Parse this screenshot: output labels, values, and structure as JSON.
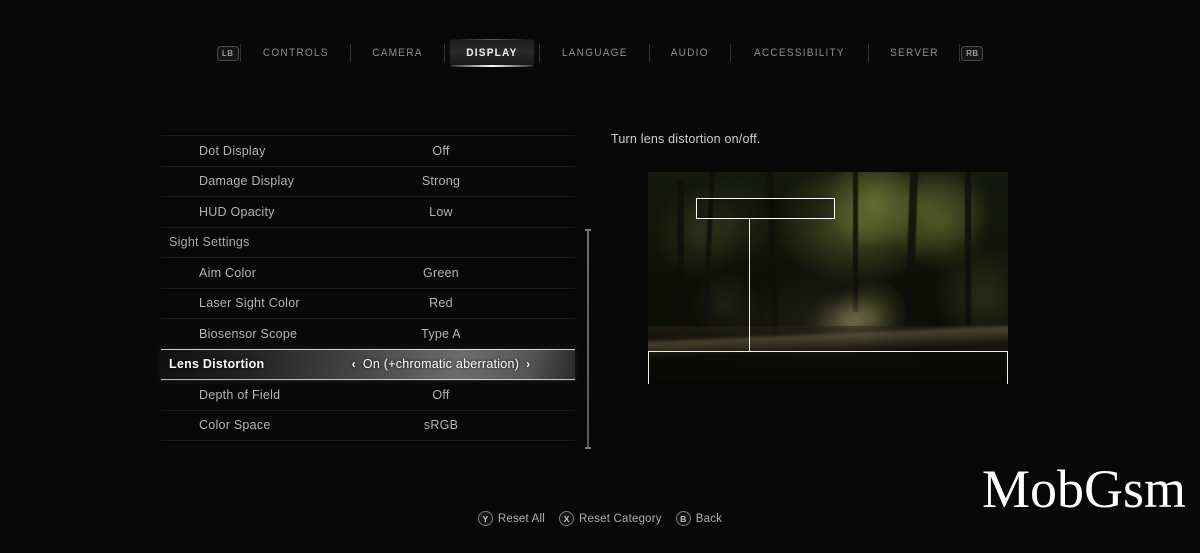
{
  "tabbar": {
    "left_bumper": "LB",
    "right_bumper": "RB",
    "tabs": [
      {
        "label": "CONTROLS",
        "active": false
      },
      {
        "label": "CAMERA",
        "active": false
      },
      {
        "label": "DISPLAY",
        "active": true
      },
      {
        "label": "LANGUAGE",
        "active": false
      },
      {
        "label": "AUDIO",
        "active": false
      },
      {
        "label": "ACCESSIBILITY",
        "active": false
      },
      {
        "label": "SERVER",
        "active": false
      }
    ]
  },
  "settings": {
    "rows": [
      {
        "label": "Dot Display",
        "value": "Off",
        "type": "option",
        "selected": false
      },
      {
        "label": "Damage Display",
        "value": "Strong",
        "type": "option",
        "selected": false
      },
      {
        "label": "HUD Opacity",
        "value": "Low",
        "type": "option",
        "selected": false
      },
      {
        "label": "Sight Settings",
        "value": "",
        "type": "header",
        "selected": false
      },
      {
        "label": "Aim Color",
        "value": "Green",
        "type": "option",
        "selected": false
      },
      {
        "label": "Laser Sight Color",
        "value": "Red",
        "type": "option",
        "selected": false
      },
      {
        "label": "Biosensor Scope",
        "value": "Type A",
        "type": "option",
        "selected": false
      },
      {
        "label": "Lens Distortion",
        "value": "On (+chromatic aberration)",
        "type": "option",
        "selected": true
      },
      {
        "label": "Depth of Field",
        "value": "Off",
        "type": "option",
        "selected": false
      },
      {
        "label": "Color Space",
        "value": "sRGB",
        "type": "option",
        "selected": false
      }
    ],
    "arrow_left": "‹",
    "arrow_right": "›"
  },
  "detail": {
    "description": "Turn lens distortion on/off."
  },
  "footer": {
    "hints": [
      {
        "glyph": "Y",
        "label": "Reset All"
      },
      {
        "glyph": "X",
        "label": "Reset Category"
      },
      {
        "glyph": "B",
        "label": "Back"
      }
    ]
  },
  "watermark": {
    "text": "MobGsm"
  },
  "colors": {
    "background": "#080808",
    "text_primary": "#b4b4b4",
    "text_selected": "#ffffff",
    "accent_underline": "#ffffff",
    "separator": "#4a4a4a"
  }
}
